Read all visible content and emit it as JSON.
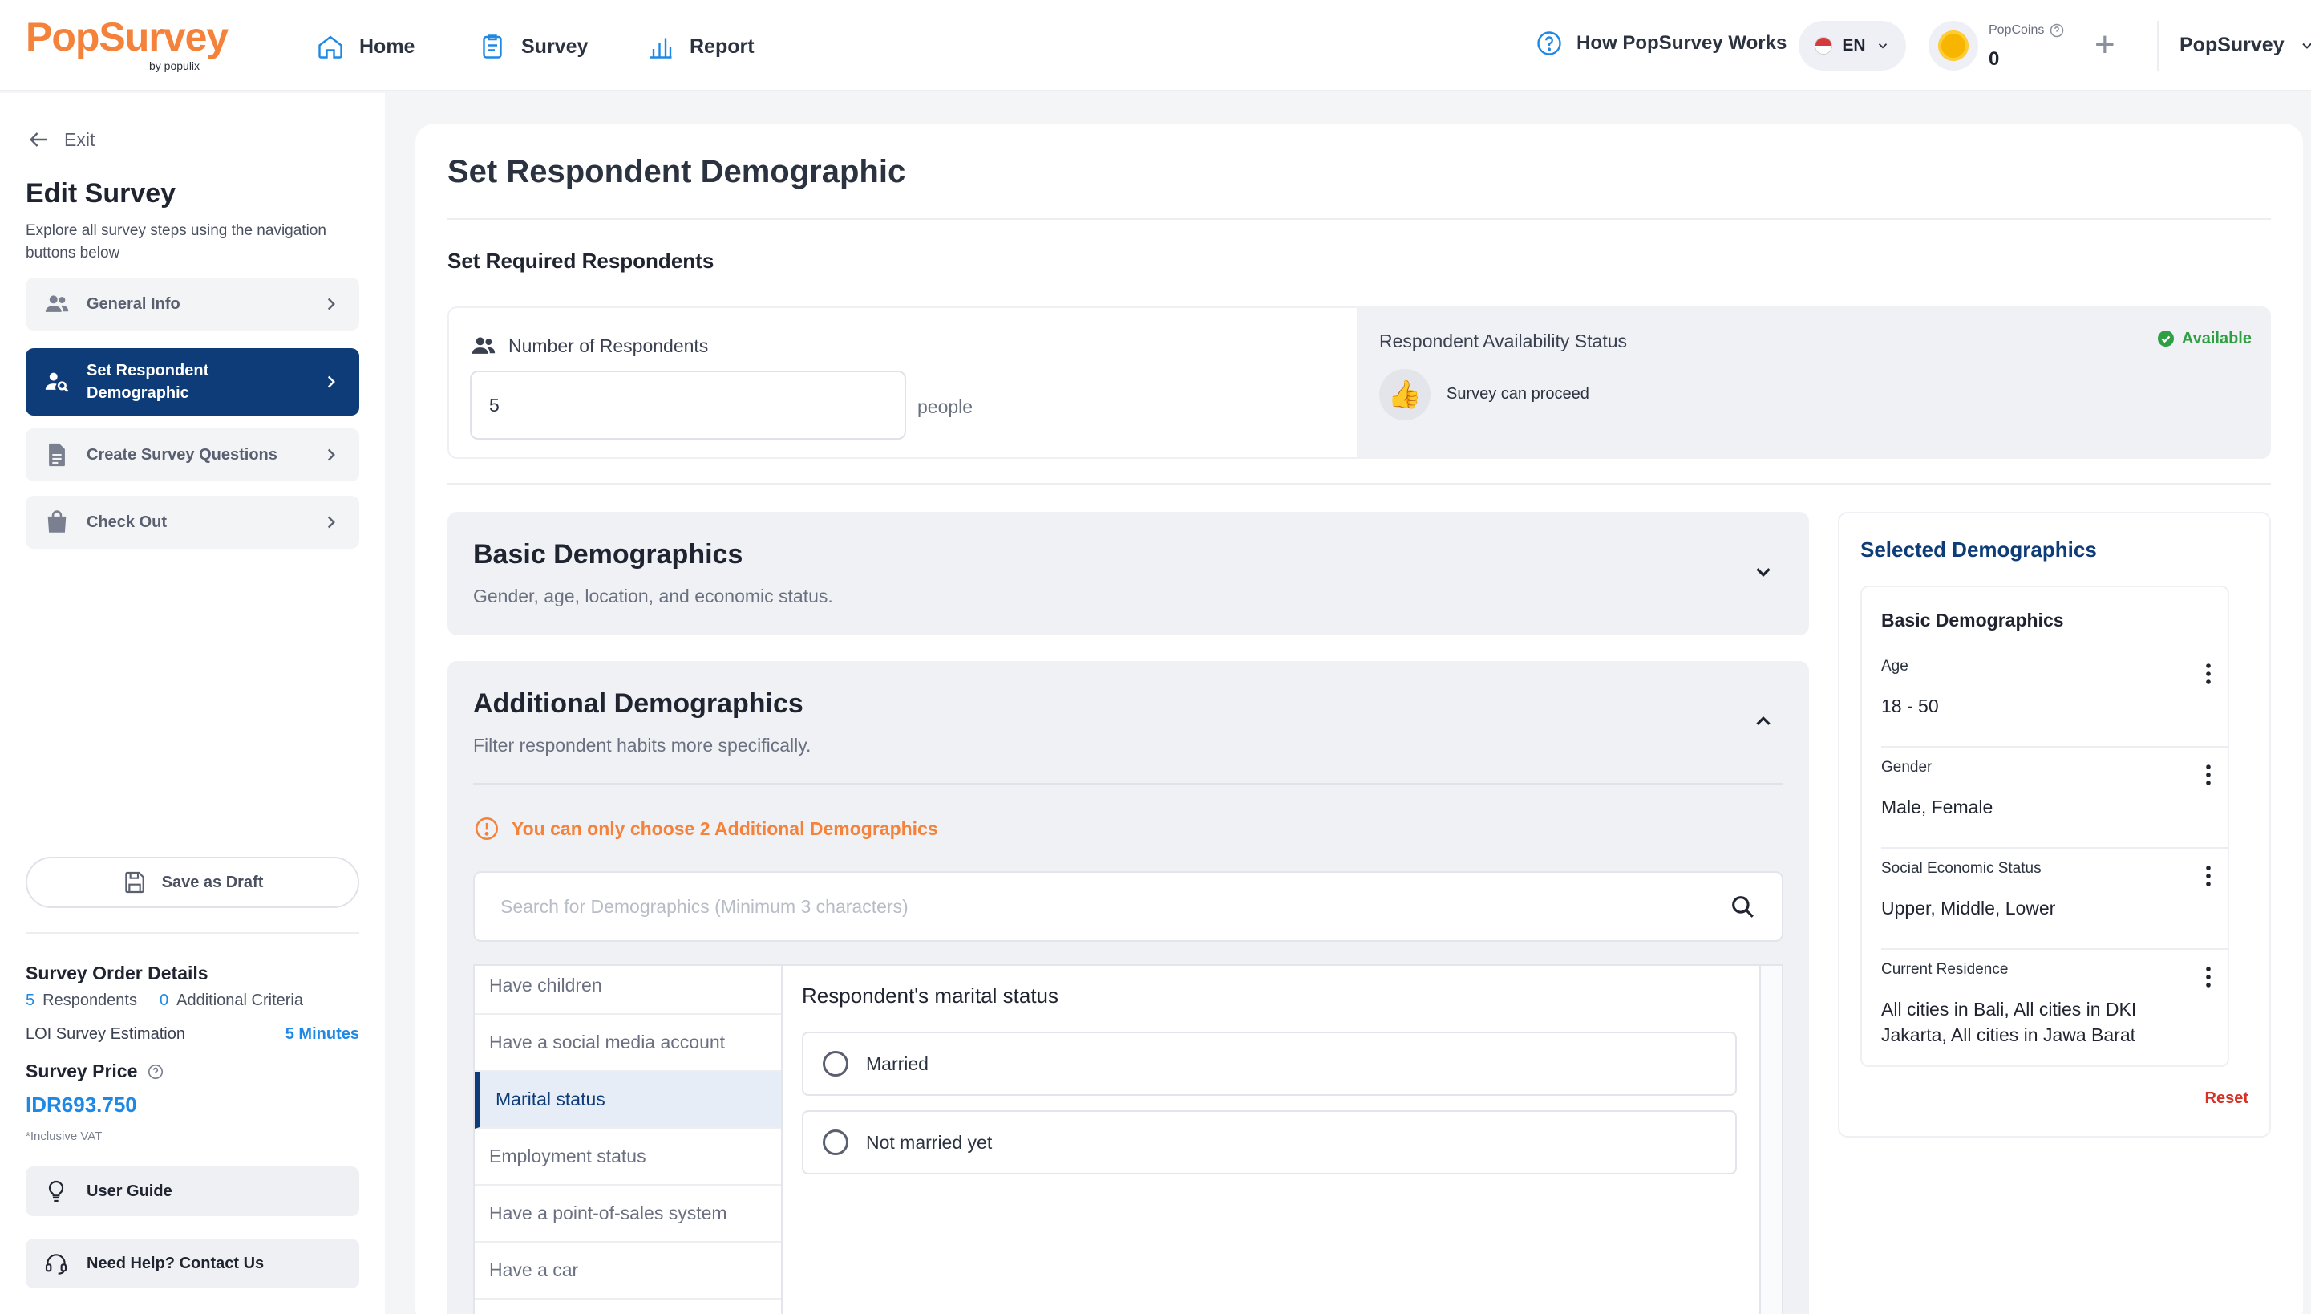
{
  "topbar": {
    "logo": "PopSurvey",
    "logo_sub": "by populix",
    "nav": [
      {
        "label": "Home",
        "icon": "home-icon"
      },
      {
        "label": "Survey",
        "icon": "clipboard-icon"
      },
      {
        "label": "Report",
        "icon": "bar-chart-icon"
      }
    ],
    "how_it_works": "How PopSurvey Works",
    "language": "EN",
    "popcoins_label": "PopCoins",
    "popcoins_value": "0",
    "account": "PopSurvey"
  },
  "sidebar": {
    "exit": "Exit",
    "title": "Edit Survey",
    "description": "Explore all survey steps using the navigation buttons below",
    "steps": [
      {
        "label": "General Info",
        "icon": "people-icon",
        "active": false
      },
      {
        "label": "Set Respondent Demographic",
        "icon": "person-search-icon",
        "active": true
      },
      {
        "label": "Create Survey Questions",
        "icon": "document-icon",
        "active": false
      },
      {
        "label": "Check Out",
        "icon": "shopping-bag-icon",
        "active": false
      }
    ],
    "save_draft": "Save as Draft",
    "order": {
      "title": "Survey Order Details",
      "respondents_count": "5",
      "respondents_label": "Respondents",
      "criteria_count": "0",
      "criteria_label": "Additional Criteria",
      "loi_label": "LOI Survey Estimation",
      "loi_value": "5 Minutes",
      "price_label": "Survey Price",
      "price_value": "IDR693.750",
      "vat_note": "*Inclusive VAT"
    },
    "user_guide": "User Guide",
    "contact": "Need Help? Contact Us"
  },
  "main": {
    "title": "Set Respondent Demographic",
    "required_title": "Set Required Respondents",
    "respondents_label": "Number of Respondents",
    "respondents_value": "5",
    "people_unit": "people",
    "availability_label": "Respondent Availability Status",
    "availability_status": "Available",
    "availability_message": "Survey can proceed",
    "basic": {
      "title": "Basic Demographics",
      "subtitle": "Gender, age, location, and economic status."
    },
    "additional": {
      "title": "Additional Demographics",
      "subtitle": "Filter respondent habits more specifically.",
      "warning": "You can only choose 2 Additional Demographics",
      "search_placeholder": "Search for Demographics (Minimum 3 characters)",
      "options": [
        "Have children",
        "Have a social media account",
        "Marital status",
        "Employment status",
        "Have a point-of-sales system",
        "Have a car"
      ],
      "active_option": "Marital status",
      "question": "Respondent's marital status",
      "answers": [
        "Married",
        "Not married yet"
      ]
    }
  },
  "selected": {
    "title": "Selected Demographics",
    "group_title": "Basic Demographics",
    "items": [
      {
        "label": "Age",
        "value": "18 - 50"
      },
      {
        "label": "Gender",
        "value": "Male, Female"
      },
      {
        "label": "Social Economic Status",
        "value": "Upper, Middle, Lower"
      },
      {
        "label": "Current Residence",
        "value": "All cities in Bali, All cities in DKI Jakarta, All cities in Jawa Barat"
      }
    ],
    "reset": "Reset"
  },
  "colors": {
    "brand_orange": "#f5823a",
    "primary_navy": "#0e3c78",
    "accent_blue": "#1e88e5",
    "success_green": "#2ea043",
    "danger_red": "#d93025"
  }
}
